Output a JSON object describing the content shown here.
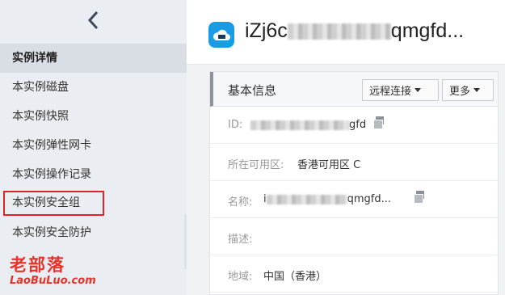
{
  "sidebar": {
    "items": [
      {
        "label": "实例详情"
      },
      {
        "label": "本实例磁盘"
      },
      {
        "label": "本实例快照"
      },
      {
        "label": "本实例弹性网卡"
      },
      {
        "label": "本实例操作记录"
      },
      {
        "label": "本实例安全组"
      },
      {
        "label": "本实例安全防护"
      }
    ]
  },
  "watermark": {
    "cn": "老部落",
    "en": "LaoBuLuo.com"
  },
  "header": {
    "title_start": "iZj6c",
    "title_end": "qmgfd..."
  },
  "panel": {
    "title": "基本信息",
    "remote_button": "远程连接",
    "more_button": "更多",
    "rows": [
      {
        "label": "ID:",
        "value_end": "gfd"
      },
      {
        "label": "所在可用区:",
        "value": "香港可用区 C"
      },
      {
        "label": "名称:",
        "value_start": "i",
        "value_end": "qmgfd..."
      },
      {
        "label": "描述:"
      },
      {
        "label": "地域:",
        "value": "中国（香港）"
      }
    ]
  },
  "colors": {
    "accent": "#1a9be6",
    "highlight": "#e02424",
    "watermark": "#e8332a"
  }
}
